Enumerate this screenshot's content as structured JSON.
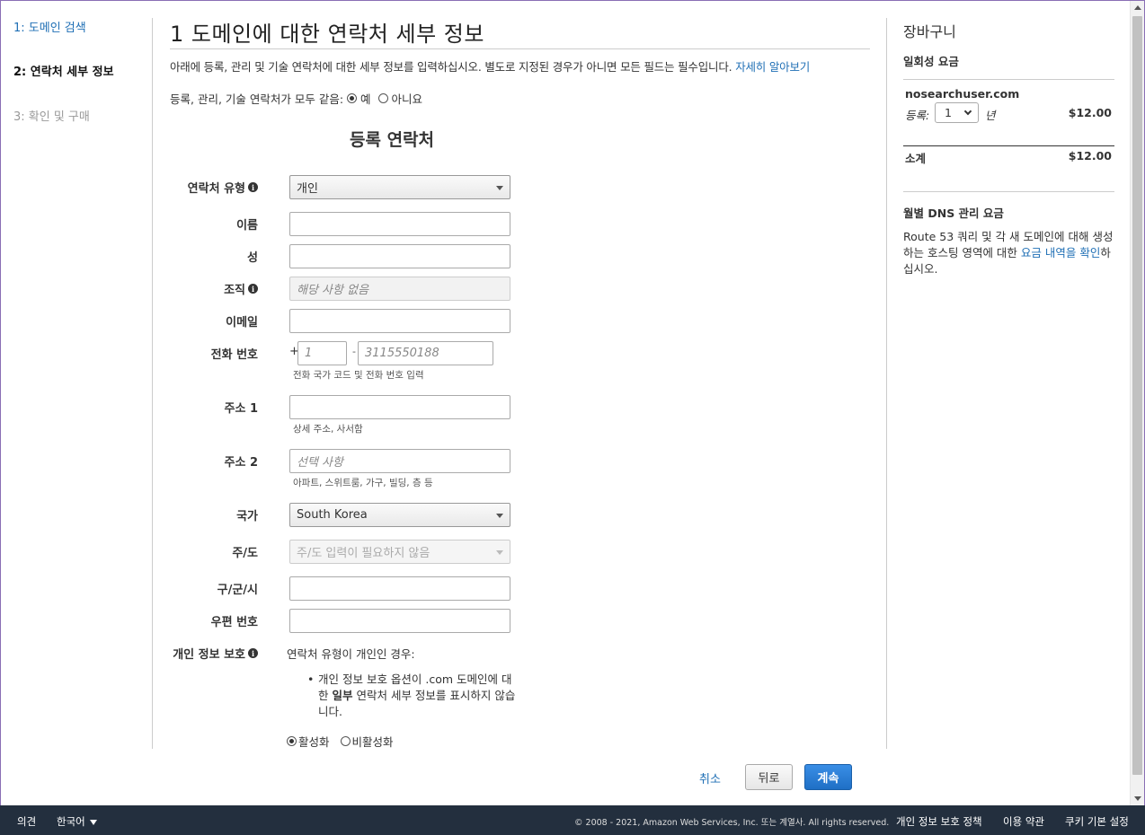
{
  "steps": [
    {
      "label": "1: 도메인 검색"
    },
    {
      "label": "2: 연락처 세부 정보"
    },
    {
      "label": "3: 확인 및 구매"
    }
  ],
  "header": {
    "title": "1 도메인에 대한 연락처 세부 정보",
    "intro": "아래에 등록, 관리 및 기술 연락처에 대한 세부 정보를 입력하십시오. 별도로 지정된 경우가 아니면 모든 필드는 필수입니다.",
    "learn_more": "자세히 알아보기",
    "same_contacts_label": "등록, 관리, 기술 연락처가 모두 같음:",
    "yes": "예",
    "no": "아니요"
  },
  "form": {
    "section_title": "등록 연락처",
    "contact_type": {
      "label": "연락처 유형",
      "value": "개인"
    },
    "first_name": {
      "label": "이름",
      "value": ""
    },
    "last_name": {
      "label": "성",
      "value": ""
    },
    "organization": {
      "label": "조직",
      "placeholder": "해당 사항 없음"
    },
    "email": {
      "label": "이메일",
      "value": ""
    },
    "phone": {
      "label": "전화 번호",
      "plus": "+",
      "dash": "-",
      "country_placeholder": "1",
      "number_placeholder": "3115550188",
      "hint": "전화 국가 코드 및 전화 번호 입력"
    },
    "address1": {
      "label": "주소 1",
      "value": "",
      "hint": "상세 주소, 사서함"
    },
    "address2": {
      "label": "주소 2",
      "placeholder": "선택 사항",
      "hint": "아파트, 스위트룸, 가구, 빌딩, 층 등"
    },
    "country": {
      "label": "국가",
      "value": "South Korea"
    },
    "state": {
      "label": "주/도",
      "value": "주/도 입력이 필요하지 않음"
    },
    "city": {
      "label": "구/군/시",
      "value": ""
    },
    "postal": {
      "label": "우편 번호",
      "value": ""
    },
    "privacy": {
      "label": "개인 정보 보호",
      "text": "연락처 유형이 개인인 경우:",
      "bullet_a": "개인 정보 보호 옵션이 .com 도메인에 대한 ",
      "bullet_bold": "일부",
      "bullet_b": " 연락처 세부 정보를 표시하지 않습니다.",
      "enable": "활성화",
      "disable": "비활성화"
    }
  },
  "actions": {
    "cancel": "취소",
    "back": "뒤로",
    "continue": "계속"
  },
  "cart": {
    "title": "장바구니",
    "one_time": "일회성 요금",
    "domain": "nosearchuser.com",
    "registration_label": "등록:",
    "years_value": "1",
    "years_unit": "년",
    "price": "$12.00",
    "subtotal_label": "소계",
    "subtotal": "$12.00",
    "dns_title": "월별 DNS 관리 요금",
    "dns_text_a": "Route 53 쿼리 및 각 새 도메인에 대해 생성하는 호스팅 영역에 대한 ",
    "dns_link": "요금 내역을 확인",
    "dns_text_b": "하십시오."
  },
  "footer": {
    "feedback": "의견",
    "language": "한국어",
    "copyright": "© 2008 - 2021, Amazon Web Services, Inc. 또는 계열사. All rights reserved.",
    "privacy": "개인 정보 보호 정책",
    "terms": "이용 약관",
    "cookies": "쿠키 기본 설정"
  },
  "colors": {
    "link": "#1f6fb5",
    "primary_button": "#1f6fc5",
    "footer_bg": "#232f3e"
  }
}
